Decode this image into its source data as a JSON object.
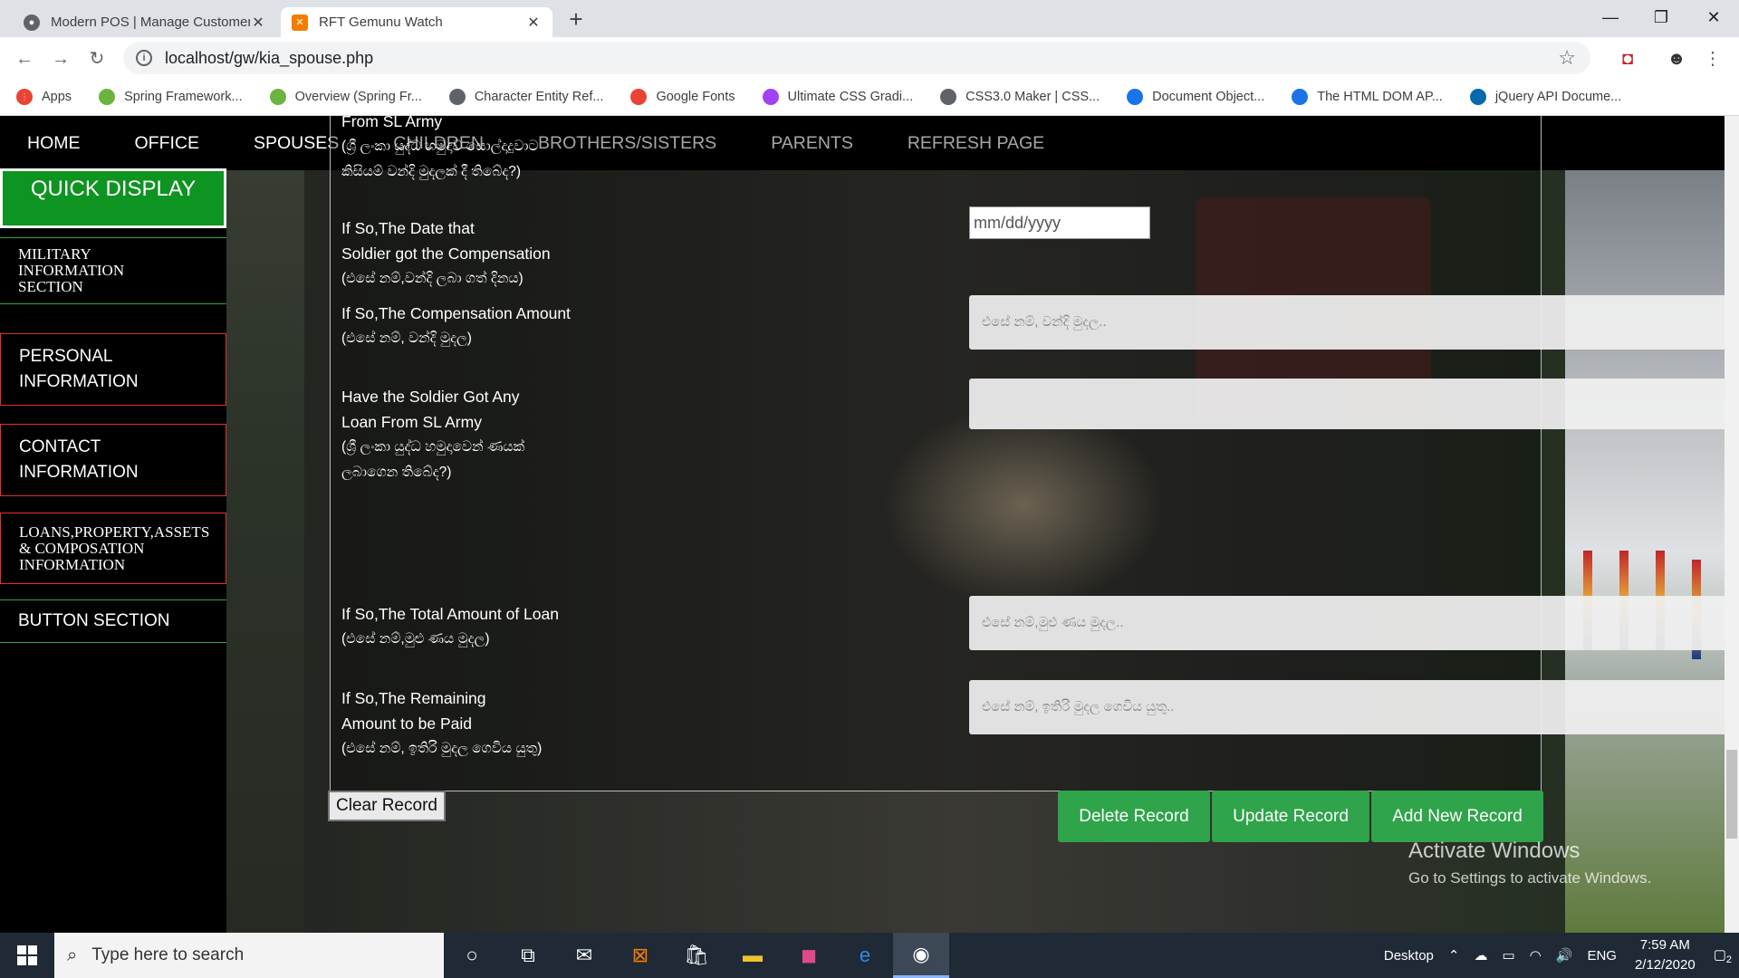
{
  "browser": {
    "tabs": [
      {
        "title": "Modern POS | Manage Customer",
        "active": false
      },
      {
        "title": "RFT Gemunu Watch",
        "active": true
      }
    ],
    "url": "localhost/gw/kia_spouse.php",
    "bookmarks": [
      {
        "label": "Apps",
        "icon": "apps-grid-icon",
        "color": "#ea4335"
      },
      {
        "label": "Spring Framework...",
        "icon": "spring-leaf-icon",
        "color": "#6db33f"
      },
      {
        "label": "Overview (Spring Fr...",
        "icon": "spring-leaf-icon",
        "color": "#6db33f"
      },
      {
        "label": "Character Entity Ref...",
        "icon": "globe-icon",
        "color": "#5f6368"
      },
      {
        "label": "Google Fonts",
        "icon": "google-fonts-icon",
        "color": "#ea4335"
      },
      {
        "label": "Ultimate CSS Gradi...",
        "icon": "gradient-icon",
        "color": "#a142f4"
      },
      {
        "label": "CSS3.0 Maker | CSS...",
        "icon": "globe-icon",
        "color": "#5f6368"
      },
      {
        "label": "Document Object...",
        "icon": "mdn-icon",
        "color": "#1a73e8"
      },
      {
        "label": "The HTML DOM AP...",
        "icon": "mdn-icon",
        "color": "#1a73e8"
      },
      {
        "label": "jQuery API Docume...",
        "icon": "jquery-icon",
        "color": "#0769ad"
      }
    ]
  },
  "nav": [
    "HOME",
    "OFFICE",
    "SPOUSES",
    "CHILDREN",
    "BROTHERS/SISTERS",
    "PARENTS",
    "REFRESH PAGE"
  ],
  "sidebar": {
    "quick_display": "QUICK DISPLAY",
    "military": [
      "MILITARY",
      "INFORMATION",
      "SECTION"
    ],
    "personal": [
      "PERSONAL",
      "INFORMATION"
    ],
    "contact": [
      "CONTACT",
      "INFORMATION"
    ],
    "loans": [
      "LOANS,PROPERTY,ASSETS",
      "& COMPOSATION",
      "INFORMATION"
    ],
    "button_section": "BUTTON SECTION"
  },
  "form": {
    "compensation_q": {
      "en_tail": "From SL Army",
      "si": [
        "(ශ්‍රී ලංකා යුද්ධ හමුදාව සොල්දාදුවාට",
        "කිසියම් වන්දි මුදලක් දී තිබේද?)"
      ]
    },
    "date": {
      "en": [
        "If So,The Date that",
        "Soldier got the Compensation"
      ],
      "si": "(එසේ නම්,වන්දි ලබා ගත් දිනය)",
      "placeholder": "mm/dd/yyyy"
    },
    "amount": {
      "en": "If So,The Compensation Amount",
      "si": "(එසේ නම්, වන්දි මුදල)",
      "placeholder": "එසේ නම්, වන්දි මුදල.."
    },
    "loan": {
      "en": [
        "Have the Soldier Got Any",
        "Loan From SL Army"
      ],
      "si": [
        "(ශ්‍රී ලංකා යුද්ධ හමුදාවෙන් ණයක්",
        "ලබාගෙන තිබේද?)"
      ]
    },
    "total_loan": {
      "en": "If So,The Total Amount of Loan",
      "si": "(එසේ නම්,මුළු ණය මුදල)",
      "placeholder": "එසේ නම්,මුළු ණය මුදල.."
    },
    "remaining": {
      "en": [
        "If So,The Remaining",
        "Amount to be Paid"
      ],
      "si": "(එසේ නම්, ඉතිරි මුදල ගෙවිය යුතු)",
      "placeholder": "එසේ නම්, ඉතිරි මුදල ගෙවිය යුතු.."
    }
  },
  "buttons": {
    "clear": "Clear Record",
    "delete": "Delete Record",
    "update": "Update Record",
    "add": "Add New Record"
  },
  "watermark": {
    "line1": "Activate Windows",
    "line2": "Go to Settings to activate Windows."
  },
  "taskbar": {
    "search_placeholder": "Type here to search",
    "desktop_label": "Desktop",
    "language": "ENG",
    "time": "7:59 AM",
    "date": "2/12/2020",
    "notification_count": "2"
  }
}
